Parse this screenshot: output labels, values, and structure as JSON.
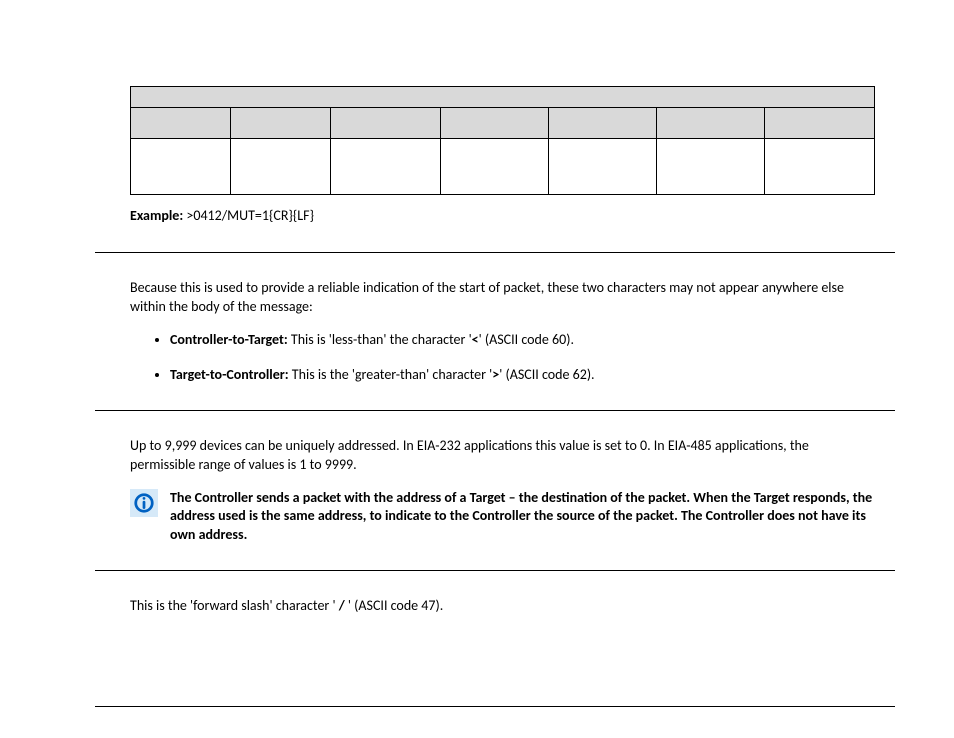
{
  "example": {
    "label": "Example:",
    "value": ">0412/MUT=1{CR}{LF}"
  },
  "p1": "Because this is used to provide a reliable indication of the start of packet, these two characters may not appear anywhere else within the body of the message:",
  "bullets": {
    "ct": {
      "label": "Controller-to-Target:",
      "pre": " This is 'less-than' the character '",
      "sym": "<",
      "post": "' (ASCII code 60)."
    },
    "tc": {
      "label": "Target-to-Controller:",
      "pre": " This is the 'greater-than' character '",
      "sym": ">",
      "post": "' (ASCII code 62)."
    }
  },
  "p2": "Up to 9,999 devices can be uniquely addressed. In EIA-232 applications this value is set to 0. In EIA-485 applications, the permissible range of values is 1 to 9999.",
  "note": "The Controller sends a packet with the address of a Target – the destination of the packet. When the Target responds, the address used is the same address, to indicate to the Controller the source of the packet. The Controller does not have its own address.",
  "p3": {
    "pre": "This is the 'forward slash' character ' ",
    "sym": "/",
    "post": " ' (ASCII code 47)."
  }
}
